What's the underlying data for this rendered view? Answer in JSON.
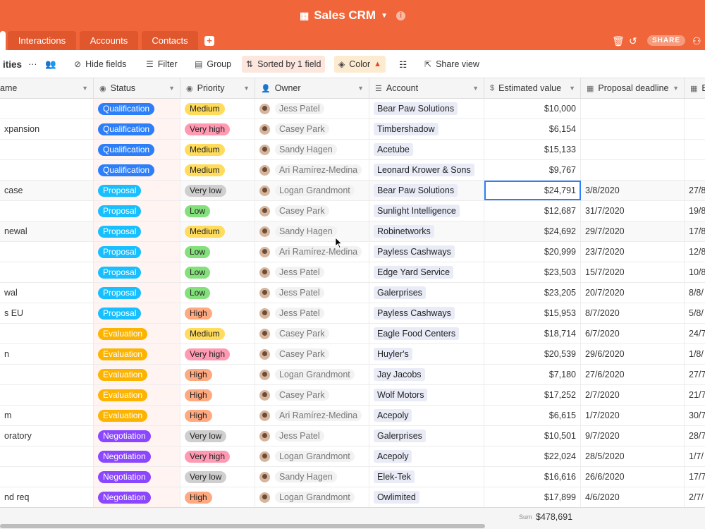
{
  "header": {
    "title": "Sales CRM",
    "title_icon": "table-icon",
    "share_label": "SHARE"
  },
  "tabs": [
    {
      "label": ""
    },
    {
      "label": "Interactions"
    },
    {
      "label": "Accounts"
    },
    {
      "label": "Contacts"
    }
  ],
  "toolbar": {
    "view_name": "ities",
    "hide_fields": "Hide fields",
    "filter": "Filter",
    "group": "Group",
    "sorted": "Sorted by 1 field",
    "color": "Color",
    "share_view": "Share view"
  },
  "columns": {
    "name": "ame",
    "status": "Status",
    "priority": "Priority",
    "owner": "Owner",
    "account": "Account",
    "estimated_value": "Estimated value",
    "proposal_deadline": "Proposal deadline",
    "extra": "E"
  },
  "colors": {
    "brand": "#f0663a",
    "Qualification": "#2d7ff9",
    "Proposal": "#18bfff",
    "Evaluation": "#fcb400",
    "Negotiation": "#8b46ff",
    "Medium": "#ffdc5c",
    "Very high": "#ff9ab2",
    "Very low": "#cfcfcf",
    "Low": "#84e07b",
    "High": "#ffa981"
  },
  "rows": [
    {
      "name": "",
      "status": "Qualification",
      "priority": "Medium",
      "owner": "Jess Patel",
      "account": "Bear Paw Solutions",
      "value": "$10,000",
      "deadline": "",
      "extra": ""
    },
    {
      "name": "xpansion",
      "status": "Qualification",
      "priority": "Very high",
      "owner": "Casey Park",
      "account": "Timbershadow",
      "value": "$6,154",
      "deadline": "",
      "extra": ""
    },
    {
      "name": "",
      "status": "Qualification",
      "priority": "Medium",
      "owner": "Sandy Hagen",
      "account": "Acetube",
      "value": "$15,133",
      "deadline": "",
      "extra": ""
    },
    {
      "name": "",
      "status": "Qualification",
      "priority": "Medium",
      "owner": "Ari Ramírez-Medina",
      "account": "Leonard Krower & Sons",
      "value": "$9,767",
      "deadline": "",
      "extra": ""
    },
    {
      "name": "case",
      "status": "Proposal",
      "priority": "Very low",
      "owner": "Logan Grandmont",
      "account": "Bear Paw Solutions",
      "value": "$24,791",
      "deadline": "3/8/2020",
      "extra": "27/8"
    },
    {
      "name": "",
      "status": "Proposal",
      "priority": "Low",
      "owner": "Casey Park",
      "account": "Sunlight Intelligence",
      "value": "$12,687",
      "deadline": "31/7/2020",
      "extra": "19/8"
    },
    {
      "name": "newal",
      "status": "Proposal",
      "priority": "Medium",
      "owner": "Sandy Hagen",
      "account": "Robinetworks",
      "value": "$24,692",
      "deadline": "29/7/2020",
      "extra": "17/8"
    },
    {
      "name": "",
      "status": "Proposal",
      "priority": "Low",
      "owner": "Ari Ramírez-Medina",
      "account": "Payless Cashways",
      "value": "$20,999",
      "deadline": "23/7/2020",
      "extra": "12/8"
    },
    {
      "name": "",
      "status": "Proposal",
      "priority": "Low",
      "owner": "Jess Patel",
      "account": "Edge Yard Service",
      "value": "$23,503",
      "deadline": "15/7/2020",
      "extra": "10/8"
    },
    {
      "name": "wal",
      "status": "Proposal",
      "priority": "Low",
      "owner": "Jess Patel",
      "account": "Galerprises",
      "value": "$23,205",
      "deadline": "20/7/2020",
      "extra": "8/8/"
    },
    {
      "name": "s EU",
      "status": "Proposal",
      "priority": "High",
      "owner": "Jess Patel",
      "account": "Payless Cashways",
      "value": "$15,953",
      "deadline": "8/7/2020",
      "extra": "5/8/"
    },
    {
      "name": "",
      "status": "Evaluation",
      "priority": "Medium",
      "owner": "Casey Park",
      "account": "Eagle Food Centers",
      "value": "$18,714",
      "deadline": "6/7/2020",
      "extra": "24/7"
    },
    {
      "name": "n",
      "status": "Evaluation",
      "priority": "Very high",
      "owner": "Casey Park",
      "account": "Huyler's",
      "value": "$20,539",
      "deadline": "29/6/2020",
      "extra": "1/8/"
    },
    {
      "name": "",
      "status": "Evaluation",
      "priority": "High",
      "owner": "Logan Grandmont",
      "account": "Jay Jacobs",
      "value": "$7,180",
      "deadline": "27/6/2020",
      "extra": "27/7"
    },
    {
      "name": "",
      "status": "Evaluation",
      "priority": "High",
      "owner": "Casey Park",
      "account": "Wolf Motors",
      "value": "$17,252",
      "deadline": "2/7/2020",
      "extra": "21/7"
    },
    {
      "name": "m",
      "status": "Evaluation",
      "priority": "High",
      "owner": "Ari Ramírez-Medina",
      "account": "Acepoly",
      "value": "$6,615",
      "deadline": "1/7/2020",
      "extra": "30/7"
    },
    {
      "name": "oratory",
      "status": "Negotiation",
      "priority": "Very low",
      "owner": "Jess Patel",
      "account": "Galerprises",
      "value": "$10,501",
      "deadline": "9/7/2020",
      "extra": "28/7"
    },
    {
      "name": "",
      "status": "Negotiation",
      "priority": "Very high",
      "owner": "Logan Grandmont",
      "account": "Acepoly",
      "value": "$22,024",
      "deadline": "28/5/2020",
      "extra": "1/7/"
    },
    {
      "name": "",
      "status": "Negotiation",
      "priority": "Very low",
      "owner": "Sandy Hagen",
      "account": "Elek-Tek",
      "value": "$16,616",
      "deadline": "26/6/2020",
      "extra": "17/7"
    },
    {
      "name": "nd req",
      "status": "Negotiation",
      "priority": "High",
      "owner": "Logan Grandmont",
      "account": "Owlimited",
      "value": "$17,899",
      "deadline": "4/6/2020",
      "extra": "2/7/"
    }
  ],
  "footer": {
    "sum_label": "Sum",
    "sum_value": "$478,691"
  }
}
